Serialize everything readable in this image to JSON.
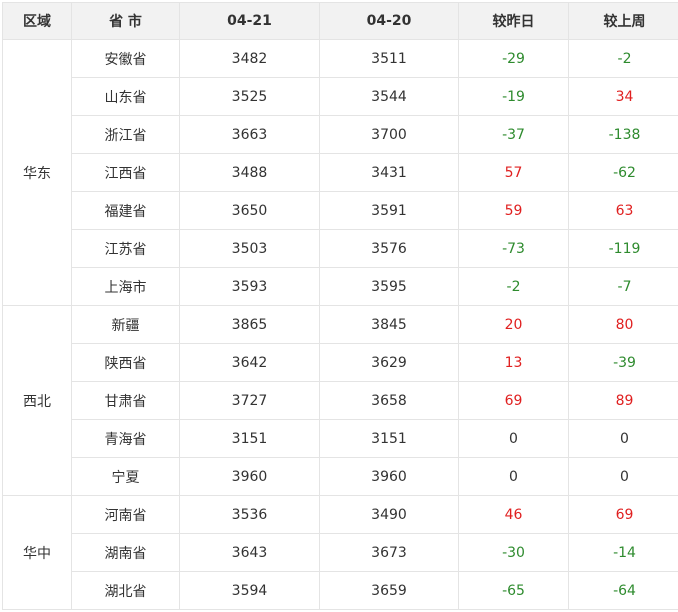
{
  "headers": [
    "区域",
    "省 市",
    "04-21",
    "04-20",
    "较昨日",
    "较上周"
  ],
  "colors": {
    "up": "#e02020",
    "down": "#2e8b2e",
    "flat": "#333333",
    "header_bg": "#f2f2f2",
    "border": "#e4e4e4"
  },
  "groups": [
    {
      "region": "华东",
      "rows": [
        {
          "province": "安徽省",
          "d0421": "3482",
          "d0420": "3511",
          "vs_yesterday": "-29",
          "vs_last_week": "-2"
        },
        {
          "province": "山东省",
          "d0421": "3525",
          "d0420": "3544",
          "vs_yesterday": "-19",
          "vs_last_week": "34"
        },
        {
          "province": "浙江省",
          "d0421": "3663",
          "d0420": "3700",
          "vs_yesterday": "-37",
          "vs_last_week": "-138"
        },
        {
          "province": "江西省",
          "d0421": "3488",
          "d0420": "3431",
          "vs_yesterday": "57",
          "vs_last_week": "-62"
        },
        {
          "province": "福建省",
          "d0421": "3650",
          "d0420": "3591",
          "vs_yesterday": "59",
          "vs_last_week": "63"
        },
        {
          "province": "江苏省",
          "d0421": "3503",
          "d0420": "3576",
          "vs_yesterday": "-73",
          "vs_last_week": "-119"
        },
        {
          "province": "上海市",
          "d0421": "3593",
          "d0420": "3595",
          "vs_yesterday": "-2",
          "vs_last_week": "-7"
        }
      ]
    },
    {
      "region": "西北",
      "rows": [
        {
          "province": "新疆",
          "d0421": "3865",
          "d0420": "3845",
          "vs_yesterday": "20",
          "vs_last_week": "80"
        },
        {
          "province": "陕西省",
          "d0421": "3642",
          "d0420": "3629",
          "vs_yesterday": "13",
          "vs_last_week": "-39"
        },
        {
          "province": "甘肃省",
          "d0421": "3727",
          "d0420": "3658",
          "vs_yesterday": "69",
          "vs_last_week": "89"
        },
        {
          "province": "青海省",
          "d0421": "3151",
          "d0420": "3151",
          "vs_yesterday": "0",
          "vs_last_week": "0"
        },
        {
          "province": "宁夏",
          "d0421": "3960",
          "d0420": "3960",
          "vs_yesterday": "0",
          "vs_last_week": "0"
        }
      ]
    },
    {
      "region": "华中",
      "rows": [
        {
          "province": "河南省",
          "d0421": "3536",
          "d0420": "3490",
          "vs_yesterday": "46",
          "vs_last_week": "69"
        },
        {
          "province": "湖南省",
          "d0421": "3643",
          "d0420": "3673",
          "vs_yesterday": "-30",
          "vs_last_week": "-14"
        },
        {
          "province": "湖北省",
          "d0421": "3594",
          "d0420": "3659",
          "vs_yesterday": "-65",
          "vs_last_week": "-64"
        }
      ]
    }
  ]
}
